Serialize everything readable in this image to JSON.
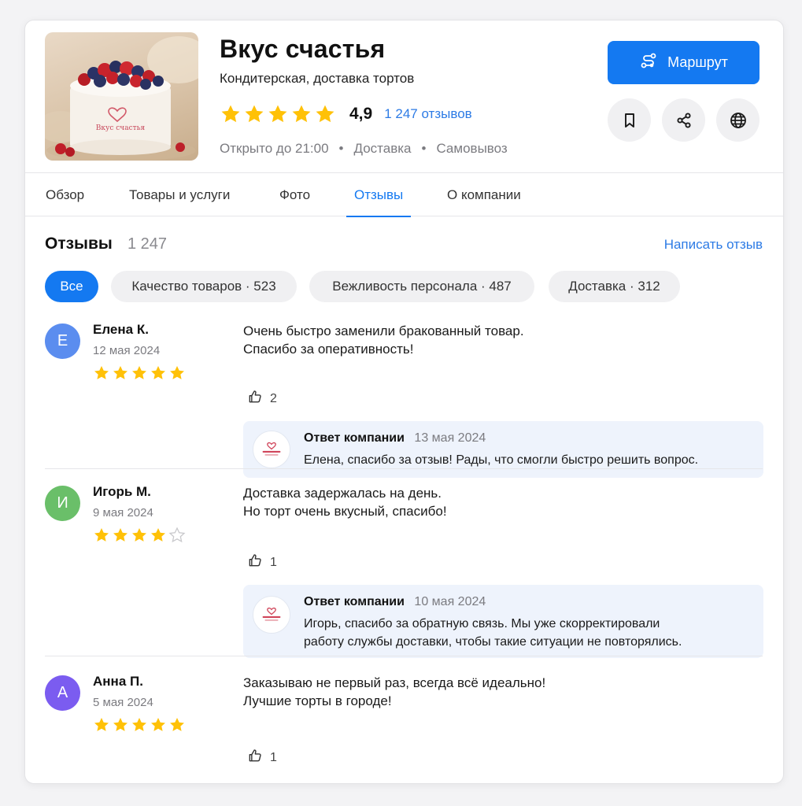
{
  "business": {
    "name": "Вкус счастья",
    "category": "Кондитерская, доставка тортов",
    "rating": "4,9",
    "rating_stars": 5,
    "reviews_link": "1 247 отзывов",
    "hours": "Открыто до 21:00",
    "feature_1": "Доставка",
    "feature_2": "Самовывоз",
    "meta_separator": "•"
  },
  "actions": {
    "route_label": "Маршрут"
  },
  "tabs": [
    {
      "label": "Обзор"
    },
    {
      "label": "Товары и услуги"
    },
    {
      "label": "Фото"
    },
    {
      "label": "Отзывы",
      "active": true
    },
    {
      "label": "О компании"
    }
  ],
  "reviews_section": {
    "title": "Отзывы",
    "count": "1 247",
    "write_link": "Написать отзыв",
    "filters": [
      {
        "label": "Все",
        "active": true
      },
      {
        "label": "Качество товаров · 523"
      },
      {
        "label": "Вежливость персонала · 487"
      },
      {
        "label": "Доставка · 312"
      }
    ]
  },
  "reviews": [
    {
      "initial": "Е",
      "avatar_color": "#5b8def",
      "author": "Елена К.",
      "date": "12 мая 2024",
      "stars": 5,
      "text": "Очень быстро заменили бракованный товар.\nСпасибо за оперативность!",
      "likes": "2",
      "reply": {
        "author": "Ответ компании",
        "date": "13 мая 2024",
        "text": "Елена, спасибо за отзыв! Рады, что смогли быстро решить вопрос."
      }
    },
    {
      "initial": "И",
      "avatar_color": "#6abf69",
      "author": "Игорь М.",
      "date": "9 мая 2024",
      "stars": 4,
      "text": "Доставка задержалась на день.\nНо торт очень вкусный, спасибо!",
      "likes": "1",
      "reply": {
        "author": "Ответ компании",
        "date": "10 мая 2024",
        "text": "Игорь, спасибо за обратную связь. Мы уже скорректировали\nработу службы доставки, чтобы такие ситуации не повторялись."
      }
    },
    {
      "initial": "А",
      "avatar_color": "#7b5cf0",
      "author": "Анна П.",
      "date": "5 мая 2024",
      "stars": 5,
      "text": "Заказываю не первый раз, всегда всё идеально!\nЛучшие торты в городе!",
      "likes": "1"
    }
  ],
  "colors": {
    "accent": "#1479f1",
    "link": "#2d7be5",
    "star": "#ffc107",
    "star_empty": "#c9c9cc",
    "reply_bg": "#eef3fc"
  },
  "icons": {
    "route": "route-icon",
    "bookmark": "bookmark-icon",
    "share": "share-icon",
    "website": "globe-icon",
    "like": "thumbs-up-icon",
    "star": "star-icon"
  }
}
